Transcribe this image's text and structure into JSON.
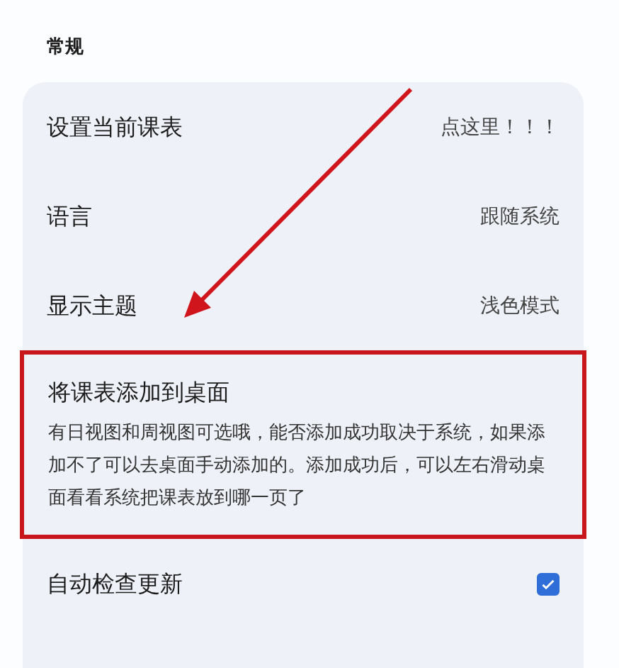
{
  "section_title": "常规",
  "items": [
    {
      "kind": "value",
      "label": "设置当前课表",
      "value": "点这里！！！",
      "highlighted": false
    },
    {
      "kind": "value",
      "label": "语言",
      "value": "跟随系统",
      "highlighted": false
    },
    {
      "kind": "value",
      "label": "显示主题",
      "value": "浅色模式",
      "highlighted": false
    },
    {
      "kind": "description",
      "label": "将课表添加到桌面",
      "description": "有日视图和周视图可选哦，能否添加成功取决于系统，如果添加不了可以去桌面手动添加的。添加成功后，可以左右滑动桌面看看系统把课表放到哪一页了",
      "highlighted": true
    },
    {
      "kind": "checkbox",
      "label": "自动检查更新",
      "checked": true,
      "highlighted": false
    }
  ],
  "annotations": [
    {
      "kind": "arrow"
    }
  ]
}
